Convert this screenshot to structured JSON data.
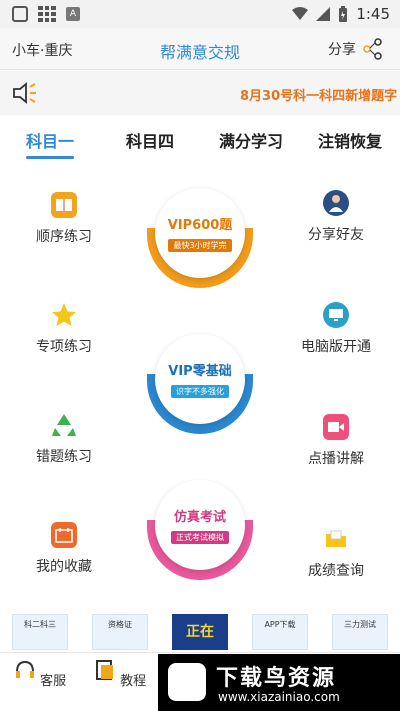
{
  "status_bar": {
    "time": "1:45",
    "a_badge": "A"
  },
  "header": {
    "city": "小车·重庆",
    "title": "帮满意交规",
    "share": "分享"
  },
  "notice": {
    "text": "8月30号科一科四新增题字"
  },
  "tabs": [
    {
      "label": "科目一"
    },
    {
      "label": "科目四"
    },
    {
      "label": "满分学习"
    },
    {
      "label": "注销恢复"
    }
  ],
  "left_items": [
    {
      "label": "顺序练习",
      "icon": "book-icon"
    },
    {
      "label": "专项练习",
      "icon": "star-icon"
    },
    {
      "label": "错题练习",
      "icon": "recycle-icon"
    },
    {
      "label": "我的收藏",
      "icon": "calendar-icon"
    }
  ],
  "right_items": [
    {
      "label": "分享好友",
      "icon": "person-icon"
    },
    {
      "label": "电脑版开通",
      "icon": "monitor-icon"
    },
    {
      "label": "点播讲解",
      "icon": "video-icon"
    },
    {
      "label": "成绩查询",
      "icon": "folder-icon"
    }
  ],
  "badges": [
    {
      "title": "VIP600题",
      "sub": "最快3小时学完",
      "color": "#f29b1a",
      "title_color": "#e07b0b"
    },
    {
      "title": "VIP零基础",
      "sub": "识字不多强化",
      "color": "#2a87d0",
      "title_color": "#1f6fb8"
    },
    {
      "title": "仿真考试",
      "sub": "正式考试模拟",
      "color": "#e8589a",
      "title_color": "#d23b83"
    }
  ],
  "banners": [
    {
      "label": "科二科三"
    },
    {
      "label": "资格证"
    },
    {
      "label": "正在"
    },
    {
      "label": "APP下载"
    },
    {
      "label": "三力测试"
    }
  ],
  "bottom_nav": [
    {
      "label": "客服"
    },
    {
      "label": "教程"
    }
  ],
  "watermark": {
    "title": "下载鸟资源",
    "url": "www.xiazainiao.com"
  },
  "colors": {
    "accent": "#2f8ad8",
    "notice": "#e8731a"
  }
}
